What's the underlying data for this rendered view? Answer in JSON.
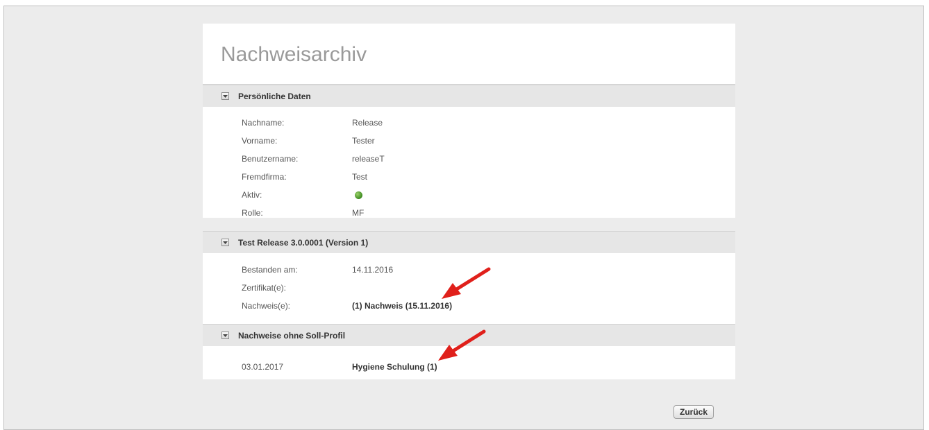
{
  "page": {
    "title": "Nachweisarchiv"
  },
  "sections": {
    "personal": {
      "title": "Persönliche Daten",
      "rows": [
        {
          "label": "Nachname:",
          "value": "Release"
        },
        {
          "label": "Vorname:",
          "value": "Tester"
        },
        {
          "label": "Benutzername:",
          "value": "releaseT"
        },
        {
          "label": "Fremdfirma:",
          "value": "Test"
        },
        {
          "label": "Aktiv:",
          "status": "active"
        },
        {
          "label": "Rolle:",
          "value": "MF"
        }
      ]
    },
    "release": {
      "title": "Test Release 3.0.0001 (Version 1)",
      "rows": [
        {
          "label": "Bestanden am:",
          "value": "14.11.2016"
        },
        {
          "label": "Zertifikat(e):",
          "value": ""
        },
        {
          "label": "Nachweis(e):",
          "value": "(1) Nachweis (15.11.2016)"
        }
      ]
    },
    "noprofile": {
      "title": "Nachweise ohne Soll-Profil",
      "rows": [
        {
          "label": "03.01.2017",
          "value": "Hygiene Schulung (1)"
        }
      ]
    }
  },
  "buttons": {
    "back": "Zurück"
  },
  "colors": {
    "active_dot": "#3c8a1f",
    "arrow": "#e0201b"
  },
  "icons": {
    "toggle": "triangle-down-icon",
    "annotation": "red-arrow"
  }
}
